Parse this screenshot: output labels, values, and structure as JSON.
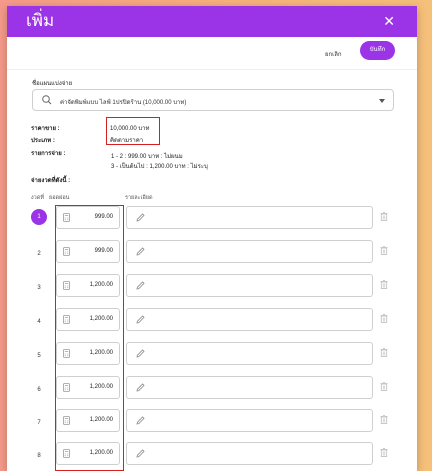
{
  "modal": {
    "title": "เพิ่ม",
    "close_icon": "close-icon",
    "cancel_label": "ยกเลิก",
    "save_label": "บันทึก"
  },
  "form": {
    "select_label": "ชื่อแผนแบ่งจ่าย",
    "select_value": "ค่าจัดพิมพ์แบบ ไลฟ์ 1ปรปิดร้าน (10,000.00 บาท)",
    "price_label": "ราคาขาย :",
    "price_value": "10,000.00 บาท",
    "type_label": "ประเภท :",
    "type_value": "คิดตามราคา",
    "schedule_label": "รายการจ่าย :",
    "schedule_lines": [
      "1 - 2 : 999.00 บาท : ไม่ผนม",
      "3 - เป็นต้นไป : 1,200.00 บาท : ไม่ระบุ"
    ],
    "installments_label": "จ่ายงวดที่ดังนี้ :"
  },
  "table": {
    "col_period": "งวดที่",
    "col_amount": "ยอดผ่อน",
    "col_note": "รายละเอียด",
    "rows": [
      {
        "num": "1",
        "amount": "999.00"
      },
      {
        "num": "2",
        "amount": "999.00"
      },
      {
        "num": "3",
        "amount": "1,200.00"
      },
      {
        "num": "4",
        "amount": "1,200.00"
      },
      {
        "num": "5",
        "amount": "1,200.00"
      },
      {
        "num": "6",
        "amount": "1,200.00"
      },
      {
        "num": "7",
        "amount": "1,200.00"
      },
      {
        "num": "8",
        "amount": "1,200.00"
      }
    ]
  },
  "colors": {
    "accent": "#9b34e6",
    "highlight_box": "#d32020"
  }
}
